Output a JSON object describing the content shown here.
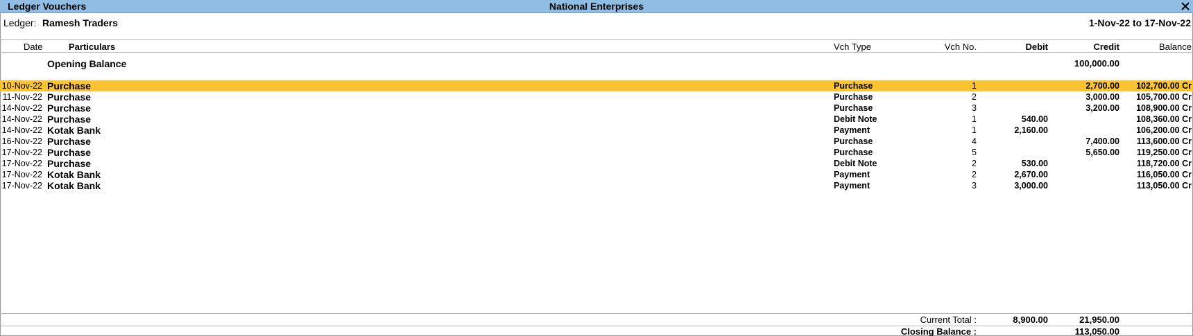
{
  "window": {
    "title": "Ledger Vouchers",
    "company": "National Enterprises",
    "close_icon": "close-icon"
  },
  "header": {
    "ledger_label": "Ledger:",
    "ledger_name": "Ramesh Traders",
    "period": "1-Nov-22 to 17-Nov-22"
  },
  "columns": {
    "date": "Date",
    "particulars": "Particulars",
    "vch_type": "Vch Type",
    "vch_no": "Vch No.",
    "debit": "Debit",
    "credit": "Credit",
    "balance": "Balance"
  },
  "opening": {
    "label": "Opening Balance",
    "credit": "100,000.00"
  },
  "selected_row_color": "#fbc433",
  "rows": [
    {
      "date": "10-Nov-22",
      "particulars": "Purchase",
      "vch_type": "Purchase",
      "vch_no": "1",
      "debit": "",
      "credit": "2,700.00",
      "balance": "102,700.00 Cr"
    },
    {
      "date": "11-Nov-22",
      "particulars": "Purchase",
      "vch_type": "Purchase",
      "vch_no": "2",
      "debit": "",
      "credit": "3,000.00",
      "balance": "105,700.00 Cr"
    },
    {
      "date": "14-Nov-22",
      "particulars": "Purchase",
      "vch_type": "Purchase",
      "vch_no": "3",
      "debit": "",
      "credit": "3,200.00",
      "balance": "108,900.00 Cr"
    },
    {
      "date": "14-Nov-22",
      "particulars": "Purchase",
      "vch_type": "Debit Note",
      "vch_no": "1",
      "debit": "540.00",
      "credit": "",
      "balance": "108,360.00 Cr"
    },
    {
      "date": "14-Nov-22",
      "particulars": "Kotak Bank",
      "vch_type": "Payment",
      "vch_no": "1",
      "debit": "2,160.00",
      "credit": "",
      "balance": "106,200.00 Cr"
    },
    {
      "date": "16-Nov-22",
      "particulars": "Purchase",
      "vch_type": "Purchase",
      "vch_no": "4",
      "debit": "",
      "credit": "7,400.00",
      "balance": "113,600.00 Cr"
    },
    {
      "date": "17-Nov-22",
      "particulars": "Purchase",
      "vch_type": "Purchase",
      "vch_no": "5",
      "debit": "",
      "credit": "5,650.00",
      "balance": "119,250.00 Cr"
    },
    {
      "date": "17-Nov-22",
      "particulars": "Purchase",
      "vch_type": "Debit Note",
      "vch_no": "2",
      "debit": "530.00",
      "credit": "",
      "balance": "118,720.00 Cr"
    },
    {
      "date": "17-Nov-22",
      "particulars": "Kotak Bank",
      "vch_type": "Payment",
      "vch_no": "2",
      "debit": "2,670.00",
      "credit": "",
      "balance": "116,050.00 Cr"
    },
    {
      "date": "17-Nov-22",
      "particulars": "Kotak Bank",
      "vch_type": "Payment",
      "vch_no": "3",
      "debit": "3,000.00",
      "credit": "",
      "balance": "113,050.00 Cr"
    }
  ],
  "totals": {
    "current_total_label": "Current Total :",
    "current_total_debit": "8,900.00",
    "current_total_credit": "21,950.00",
    "closing_label": "Closing Balance :",
    "closing_credit": "113,050.00"
  }
}
